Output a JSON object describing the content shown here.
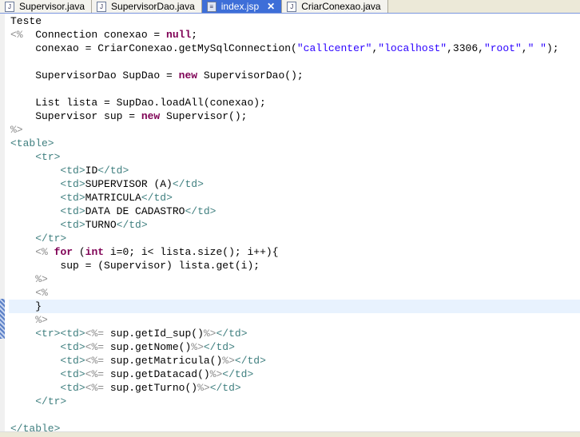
{
  "tabs": [
    {
      "label": "Supervisor.java",
      "icon": "java-file-icon",
      "active": false
    },
    {
      "label": "SupervisorDao.java",
      "icon": "java-file-icon",
      "active": false
    },
    {
      "label": "index.jsp",
      "icon": "jsp-file-icon",
      "active": true,
      "close": "✕"
    },
    {
      "label": "CriarConexao.java",
      "icon": "java-file-icon",
      "active": false
    }
  ],
  "colors": {
    "tag": "#3f7f7f",
    "jsp": "#8c8c8c",
    "keyword": "#7f0055",
    "string": "#2a00ff",
    "current_line": "#e8f2fe"
  },
  "current_line": 21,
  "lines": [
    [
      [
        "t",
        "Teste"
      ]
    ],
    [
      [
        "jsp",
        "<%"
      ],
      [
        "t",
        "  Connection conexao = "
      ],
      [
        "kw",
        "null"
      ],
      [
        "t",
        ";"
      ]
    ],
    [
      [
        "t",
        "    conexao = CriarConexao.getMySqlConnection("
      ],
      [
        "str",
        "\"callcenter\""
      ],
      [
        "t",
        ","
      ],
      [
        "str",
        "\"localhost\""
      ],
      [
        "t",
        ",3306,"
      ],
      [
        "str",
        "\"root\""
      ],
      [
        "t",
        ","
      ],
      [
        "str",
        "\" \""
      ],
      [
        "t",
        ");"
      ]
    ],
    [],
    [
      [
        "t",
        "    SupervisorDao SupDao = "
      ],
      [
        "kw",
        "new"
      ],
      [
        "t",
        " SupervisorDao();"
      ]
    ],
    [],
    [
      [
        "t",
        "    List lista = SupDao.loadAll(conexao);"
      ]
    ],
    [
      [
        "t",
        "    Supervisor sup = "
      ],
      [
        "kw",
        "new"
      ],
      [
        "t",
        " Supervisor();"
      ]
    ],
    [
      [
        "jsp",
        "%>"
      ]
    ],
    [
      [
        "tag",
        "<table>"
      ]
    ],
    [
      [
        "t",
        "    "
      ],
      [
        "tag",
        "<tr>"
      ]
    ],
    [
      [
        "t",
        "        "
      ],
      [
        "tag",
        "<td>"
      ],
      [
        "t",
        "ID"
      ],
      [
        "tag",
        "</td>"
      ]
    ],
    [
      [
        "t",
        "        "
      ],
      [
        "tag",
        "<td>"
      ],
      [
        "t",
        "SUPERVISOR (A)"
      ],
      [
        "tag",
        "</td>"
      ]
    ],
    [
      [
        "t",
        "        "
      ],
      [
        "tag",
        "<td>"
      ],
      [
        "t",
        "MATRICULA"
      ],
      [
        "tag",
        "</td>"
      ]
    ],
    [
      [
        "t",
        "        "
      ],
      [
        "tag",
        "<td>"
      ],
      [
        "t",
        "DATA DE CADASTRO"
      ],
      [
        "tag",
        "</td>"
      ]
    ],
    [
      [
        "t",
        "        "
      ],
      [
        "tag",
        "<td>"
      ],
      [
        "t",
        "TURNO"
      ],
      [
        "tag",
        "</td>"
      ]
    ],
    [
      [
        "t",
        "    "
      ],
      [
        "tag",
        "</tr>"
      ]
    ],
    [
      [
        "t",
        "    "
      ],
      [
        "jsp",
        "<%"
      ],
      [
        "t",
        " "
      ],
      [
        "kw",
        "for"
      ],
      [
        "t",
        " ("
      ],
      [
        "kw",
        "int"
      ],
      [
        "t",
        " i=0; i< lista.size(); i++){"
      ]
    ],
    [
      [
        "t",
        "        sup = (Supervisor) lista.get(i);"
      ]
    ],
    [
      [
        "t",
        "    "
      ],
      [
        "jsp",
        "%>"
      ]
    ],
    [
      [
        "t",
        "    "
      ],
      [
        "jsp",
        "<%"
      ]
    ],
    [
      [
        "t",
        "    }"
      ]
    ],
    [
      [
        "t",
        "    "
      ],
      [
        "jsp",
        "%>"
      ]
    ],
    [
      [
        "t",
        "    "
      ],
      [
        "tag",
        "<tr><td>"
      ],
      [
        "jsp",
        "<%="
      ],
      [
        "t",
        " sup.getId_sup()"
      ],
      [
        "jsp",
        "%>"
      ],
      [
        "tag",
        "</td>"
      ]
    ],
    [
      [
        "t",
        "        "
      ],
      [
        "tag",
        "<td>"
      ],
      [
        "jsp",
        "<%="
      ],
      [
        "t",
        " sup.getNome()"
      ],
      [
        "jsp",
        "%>"
      ],
      [
        "tag",
        "</td>"
      ]
    ],
    [
      [
        "t",
        "        "
      ],
      [
        "tag",
        "<td>"
      ],
      [
        "jsp",
        "<%="
      ],
      [
        "t",
        " sup.getMatricula()"
      ],
      [
        "jsp",
        "%>"
      ],
      [
        "tag",
        "</td>"
      ]
    ],
    [
      [
        "t",
        "        "
      ],
      [
        "tag",
        "<td>"
      ],
      [
        "jsp",
        "<%="
      ],
      [
        "t",
        " sup.getDatacad()"
      ],
      [
        "jsp",
        "%>"
      ],
      [
        "tag",
        "</td>"
      ]
    ],
    [
      [
        "t",
        "        "
      ],
      [
        "tag",
        "<td>"
      ],
      [
        "jsp",
        "<%="
      ],
      [
        "t",
        " sup.getTurno()"
      ],
      [
        "jsp",
        "%>"
      ],
      [
        "tag",
        "</td>"
      ]
    ],
    [
      [
        "t",
        "    "
      ],
      [
        "tag",
        "</tr>"
      ]
    ],
    [],
    [
      [
        "tag",
        "</table>"
      ]
    ]
  ]
}
